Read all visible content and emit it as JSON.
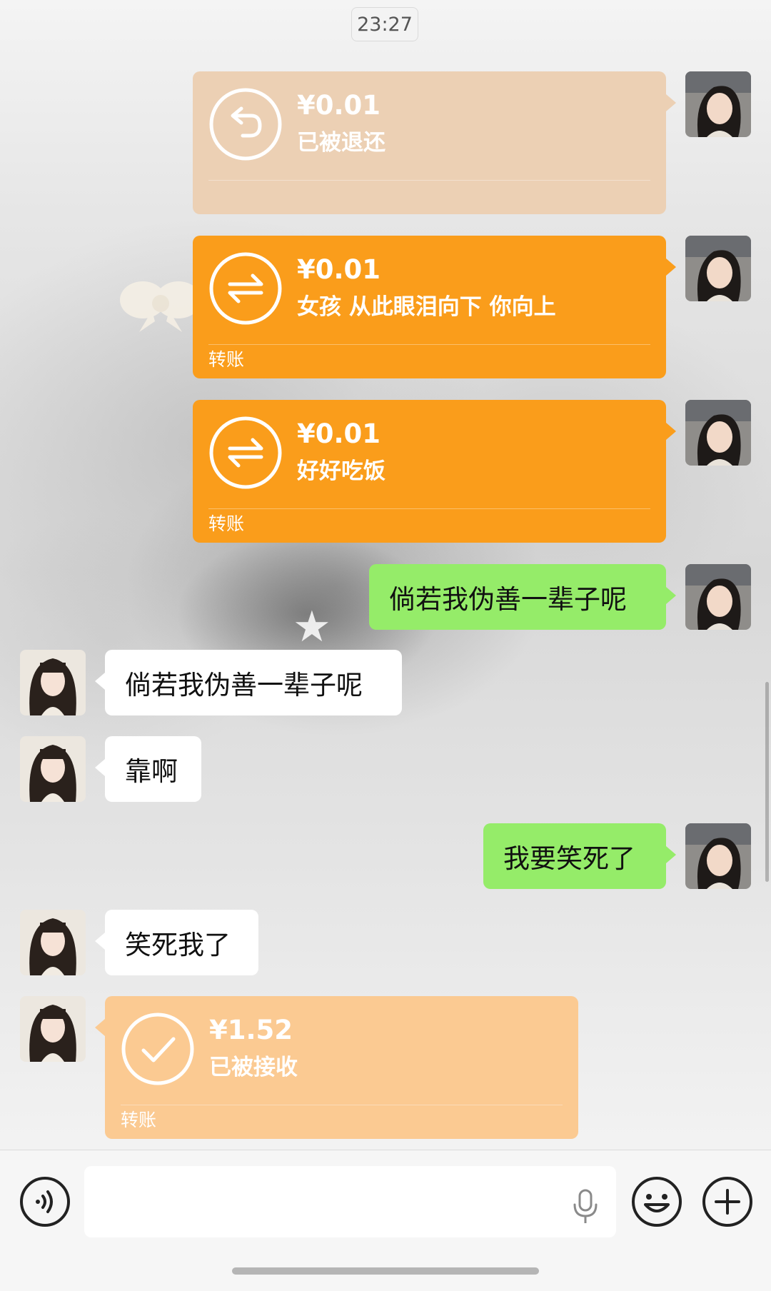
{
  "timestamp": "23:27",
  "transfer_label": "转账",
  "messages": {
    "refunded": {
      "amount": "¥0.01",
      "note": "已被退还",
      "label": ""
    },
    "t1": {
      "amount": "¥0.01",
      "note": "女孩 从此眼泪向下 你向上",
      "label": "转账"
    },
    "t2": {
      "amount": "¥0.01",
      "note": "好好吃饭",
      "label": "转账"
    },
    "m1": "倘若我伪善一辈子呢",
    "m2": "倘若我伪善一辈子呢",
    "m3": "靠啊",
    "m4": "我要笑死了",
    "m5": "笑死我了",
    "received": {
      "amount": "¥1.52",
      "note": "已被接收",
      "label": "转账"
    }
  },
  "colors": {
    "green_bubble": "#95ec69",
    "transfer_active": "#fa9d1b",
    "transfer_refunded": "#ecd0b4",
    "transfer_received": "#fbca92"
  },
  "icons": {
    "voice": "voice-mode-icon",
    "mic": "microphone-icon",
    "emoji": "emoji-icon",
    "plus": "plus-icon"
  }
}
